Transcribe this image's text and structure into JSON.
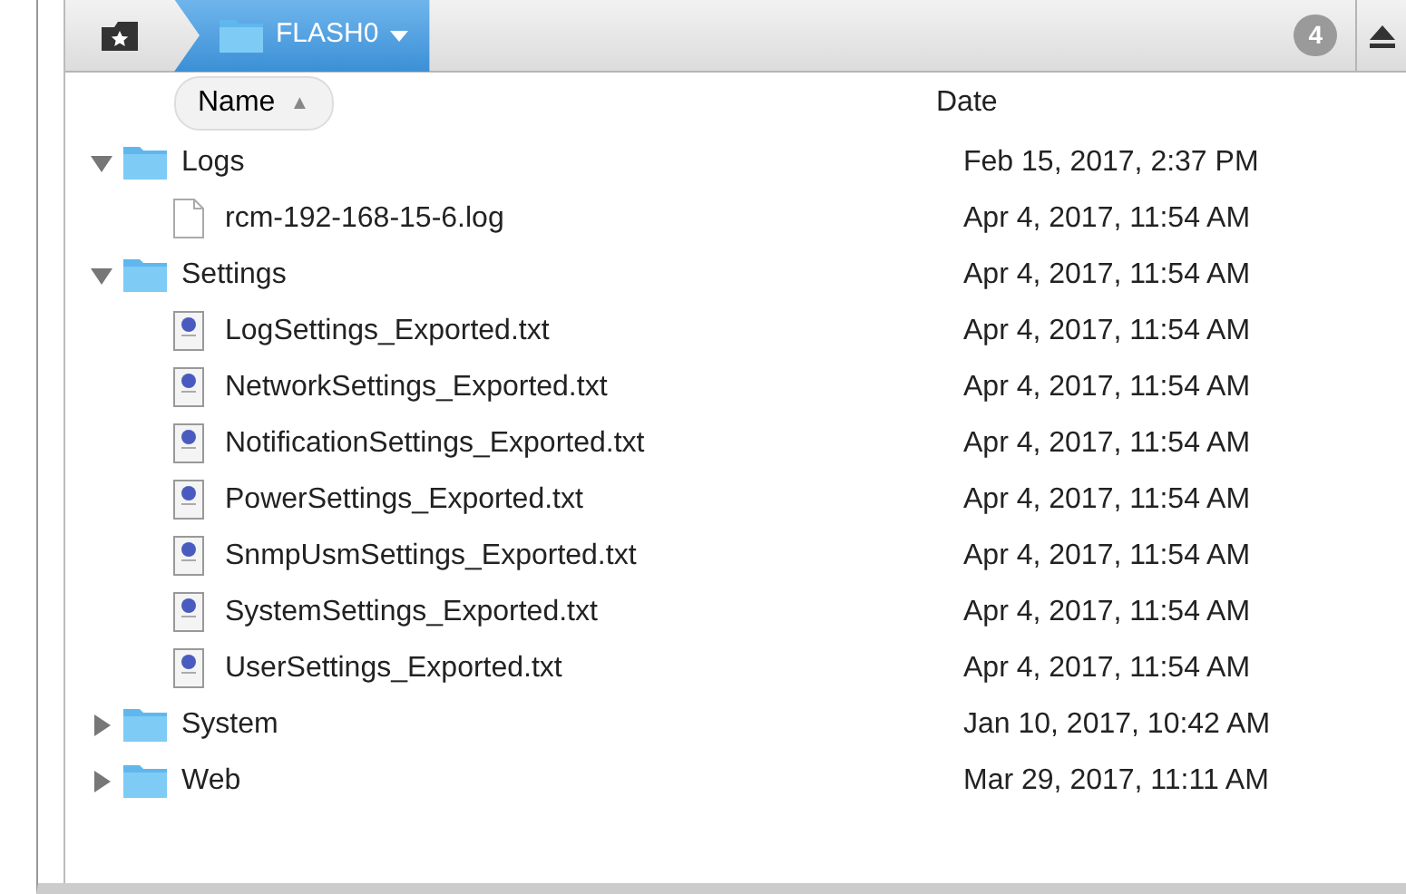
{
  "toolbar": {
    "path": "FLASH0",
    "count": "4"
  },
  "columns": [
    {
      "label": "Name",
      "sorted": true,
      "sort_mark": "▲"
    },
    {
      "label": "Date",
      "sorted": false
    }
  ],
  "items": [
    {
      "name": "Logs",
      "kind": "folder",
      "expanded": true,
      "date": "Feb 15, 2017, 2:37 PM",
      "children": [
        {
          "name": "rcm-192-168-15-6.log",
          "kind": "file",
          "date": "Apr 4, 2017, 11:54 AM"
        }
      ]
    },
    {
      "name": "Settings",
      "kind": "folder",
      "expanded": true,
      "date": "Apr 4, 2017, 11:54 AM",
      "children": [
        {
          "name": "LogSettings_Exported.txt",
          "kind": "text",
          "date": "Apr 4, 2017, 11:54 AM"
        },
        {
          "name": "NetworkSettings_Exported.txt",
          "kind": "text",
          "date": "Apr 4, 2017, 11:54 AM"
        },
        {
          "name": "NotificationSettings_Exported.txt",
          "kind": "text",
          "date": "Apr 4, 2017, 11:54 AM"
        },
        {
          "name": "PowerSettings_Exported.txt",
          "kind": "text",
          "date": "Apr 4, 2017, 11:54 AM"
        },
        {
          "name": "SnmpUsmSettings_Exported.txt",
          "kind": "text",
          "date": "Apr 4, 2017, 11:54 AM"
        },
        {
          "name": "SystemSettings_Exported.txt",
          "kind": "text",
          "date": "Apr 4, 2017, 11:54 AM"
        },
        {
          "name": "UserSettings_Exported.txt",
          "kind": "text",
          "date": "Apr 4, 2017, 11:54 AM"
        }
      ]
    },
    {
      "name": "System",
      "kind": "folder",
      "expanded": false,
      "date": "Jan 10, 2017, 10:42 AM"
    },
    {
      "name": "Web",
      "kind": "folder",
      "expanded": false,
      "date": "Mar 29, 2017, 11:11 AM"
    }
  ]
}
